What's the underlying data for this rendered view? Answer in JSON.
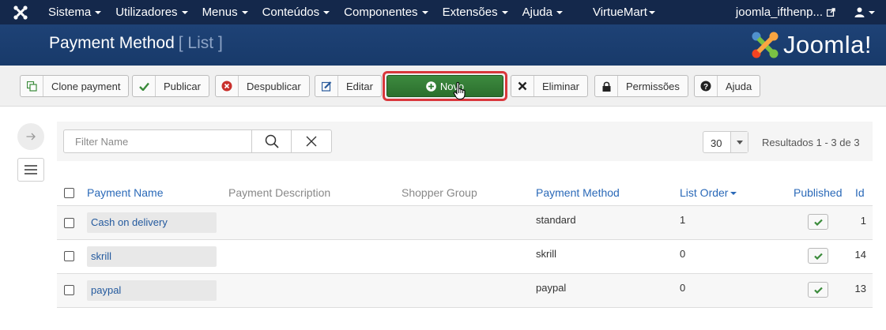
{
  "navbar": {
    "items": [
      "Sistema",
      "Utilizadores",
      "Menus",
      "Conteúdos",
      "Componentes",
      "Extensões",
      "Ajuda",
      "VirtueMart"
    ],
    "user_link": "joomla_ifthenp..."
  },
  "header": {
    "title": "Payment Method",
    "subtitle": "[ List ]",
    "brand": "Joomla!"
  },
  "toolbar": {
    "clone_label": "Clone payment",
    "publish_label": "Publicar",
    "unpublish_label": "Despublicar",
    "edit_label": "Editar",
    "new_label": "Novo",
    "delete_label": "Eliminar",
    "permissions_label": "Permissões",
    "help_label": "Ajuda"
  },
  "filter": {
    "placeholder": "Filter Name",
    "value": "",
    "limit": "30",
    "results": "Resultados 1 - 3 de 3"
  },
  "table": {
    "headers": {
      "name": "Payment Name",
      "description": "Payment Description",
      "shopper_group": "Shopper Group",
      "method": "Payment Method",
      "order": "List Order",
      "published": "Published",
      "id": "Id"
    },
    "rows": [
      {
        "name": "Cash on delivery",
        "method": "standard",
        "order": "1",
        "id": "1"
      },
      {
        "name": "skrill",
        "method": "skrill",
        "order": "0",
        "id": "14"
      },
      {
        "name": "paypal",
        "method": "paypal",
        "order": "0",
        "id": "13"
      }
    ]
  },
  "colors": {
    "navbar": "#14284b",
    "header": "#1c3d6e",
    "new_button": "#2e7d32",
    "highlight": "#d9373c",
    "link": "#2a69b8"
  }
}
